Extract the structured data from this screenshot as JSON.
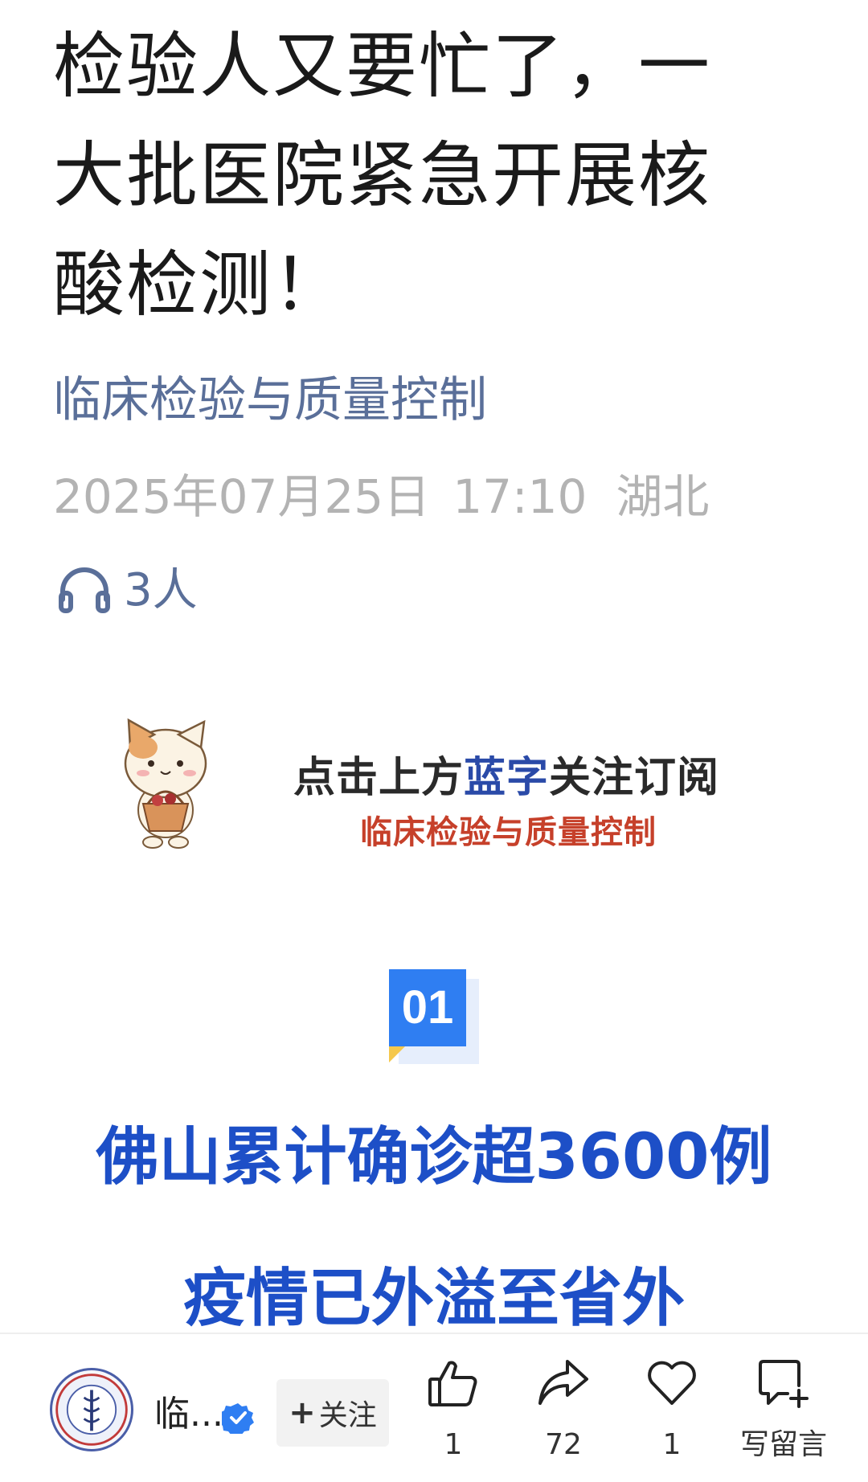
{
  "article": {
    "title_line1": "检验人又要忙了，一",
    "title_line2": "大批医院紧急开展核",
    "title_line3": "酸检测！",
    "account": "临床检验与质量控制",
    "date": "2025年07月25日",
    "time": "17:10",
    "location": "湖北",
    "listeners": "3人"
  },
  "banner": {
    "line1_a": "点击上方",
    "line1_blue": "蓝字",
    "line1_b": "关注订阅",
    "line2": "临床检验与质量控制"
  },
  "section": {
    "number": "01",
    "headline1": "佛山累计确诊超3600例",
    "headline2": "疫情已外溢至省外"
  },
  "bottom_bar": {
    "account_short": "临...",
    "follow_label": "关注",
    "follow_plus": "+",
    "like_count": "1",
    "share_count": "72",
    "heart_count": "1",
    "comment_label": "写留言"
  },
  "colors": {
    "account_link": "#5a6f99",
    "headline_blue": "#1d4fc7",
    "badge_blue": "#2f7ef2",
    "banner_red": "#c6402a"
  }
}
